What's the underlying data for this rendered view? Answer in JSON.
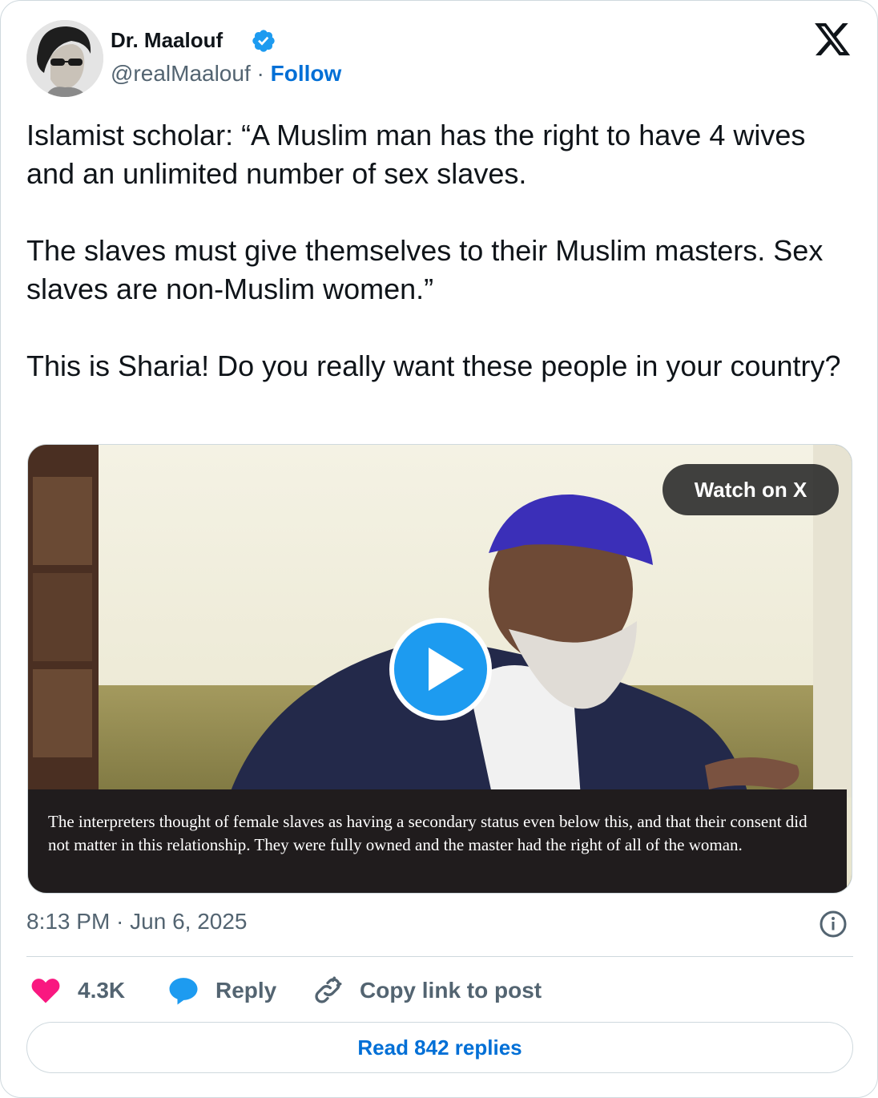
{
  "author": {
    "name": "Dr. Maalouf",
    "handle": "@realMaalouf",
    "separator": "·",
    "follow_label": "Follow"
  },
  "tweet": {
    "paragraphs": [
      "Islamist scholar: “A Muslim man has the right to have 4 wives and an unlimited number of sex slaves.",
      "The slaves must give themselves to their Muslim masters. Sex slaves are non-Muslim women.”",
      "This is Sharia! Do you really want these people in your country?"
    ]
  },
  "media": {
    "watch_label": "Watch on X",
    "caption": "The interpreters thought of female slaves as having a secondary status even below this, and that their consent did not matter in this relationship. They were fully owned and the master had the right of all of the woman."
  },
  "meta": {
    "timestamp": "8:13 PM · Jun 6, 2025"
  },
  "actions": {
    "likes": "4.3K",
    "reply_label": "Reply",
    "copy_label": "Copy link to post"
  },
  "read_replies_label": "Read 842 replies",
  "colors": {
    "link": "#006fd6",
    "secondary_text": "#536471",
    "like": "#f91880",
    "reply": "#1d9bf0",
    "verified": "#1d9bf0",
    "border": "#cfd9de"
  },
  "icons": [
    "verified-badge-icon",
    "x-logo-icon",
    "play-icon",
    "info-icon",
    "heart-icon",
    "reply-bubble-icon",
    "link-icon"
  ]
}
